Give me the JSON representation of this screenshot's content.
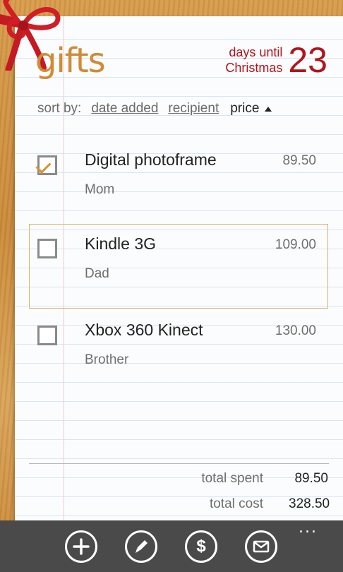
{
  "header": {
    "title": "gifts",
    "countdown_label_line1": "days until",
    "countdown_label_line2": "Christmas",
    "countdown_number": "23"
  },
  "sort": {
    "label": "sort by:",
    "options": [
      "date added",
      "recipient"
    ],
    "active": "price"
  },
  "gifts": [
    {
      "name": "Digital photoframe",
      "recipient": "Mom",
      "price": "89.50",
      "checked": true
    },
    {
      "name": "Kindle 3G",
      "recipient": "Dad",
      "price": "109.00",
      "checked": false
    },
    {
      "name": "Xbox 360 Kinect",
      "recipient": "Brother",
      "price": "130.00",
      "checked": false
    }
  ],
  "totals": {
    "spent_label": "total spent",
    "spent_value": "89.50",
    "cost_label": "total cost",
    "cost_value": "328.50"
  },
  "appbar": {
    "buttons": [
      "add-icon",
      "edit-icon",
      "dollar-icon",
      "mail-icon"
    ],
    "more": "..."
  },
  "colors": {
    "accent": "#d08b37",
    "countdown": "#b3141c",
    "check": "#d8922b",
    "appbar": "#4a4a4a"
  }
}
